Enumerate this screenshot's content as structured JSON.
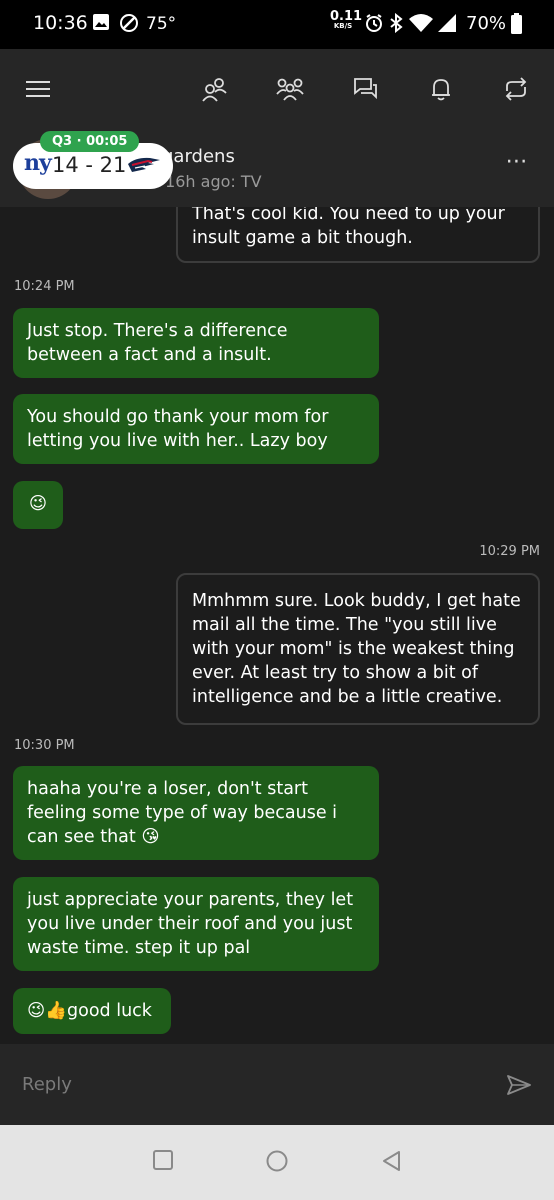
{
  "status_bar": {
    "time": "10:36",
    "temperature": "75°",
    "speed_value": "0.11",
    "speed_unit": "KB/S",
    "battery": "70%"
  },
  "app_bar": {
    "icons": [
      "menu-icon",
      "friends-icon",
      "party-icon",
      "messages-icon",
      "notifications-icon",
      "refresh-icon"
    ]
  },
  "conversation": {
    "name": "gardens",
    "status": "en 16h ago: TV"
  },
  "score_widget": {
    "period": "Q3 · 00:05",
    "home_logo": "ny",
    "score": "14 - 21",
    "away_logo": "patriots-logo"
  },
  "messages": [
    {
      "type": "out",
      "text": "That's cool kid. You need to up your insult game a bit though."
    },
    {
      "type": "time",
      "text": "10:24 PM"
    },
    {
      "type": "in",
      "text": "Just stop. There's a difference between a fact and a insult."
    },
    {
      "type": "in",
      "text": "You should go thank your mom for letting you live with her.. Lazy boy"
    },
    {
      "type": "in",
      "text": "😉"
    },
    {
      "type": "time",
      "text": "10:29 PM"
    },
    {
      "type": "out",
      "text": "Mmhmm sure. Look buddy, I get hate mail all the time. The \"you still live with your mom\" is the weakest thing ever. At least try to show a bit of intelligence and be a little creative."
    },
    {
      "type": "time",
      "text": "10:30 PM"
    },
    {
      "type": "in",
      "text": "haaha you're a loser, don't start feeling some type of way because i can see that 😘"
    },
    {
      "type": "in",
      "text": "just appreciate your parents, they let you live under their roof and you just waste time. step it up pal"
    },
    {
      "type": "in",
      "text": "😉👍good luck"
    }
  ],
  "reply": {
    "placeholder": "Reply"
  },
  "colors": {
    "incoming_bubble": "#1f5d1a",
    "score_badge": "#2fa34e",
    "background": "#1c1c1c"
  }
}
